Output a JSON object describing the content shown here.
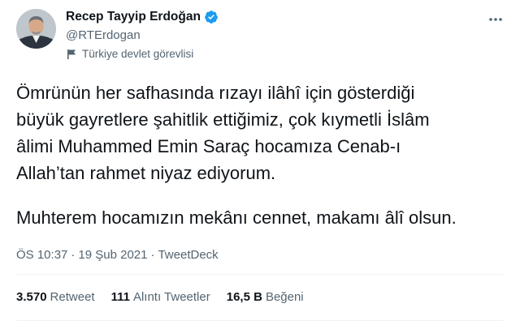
{
  "author": {
    "name": "Recep Tayyip Erdoğan",
    "handle": "@RTErdogan",
    "label": "Türkiye devlet görevlisi",
    "verified": true
  },
  "tweet": {
    "lines": [
      "Ömrünün her safhasında rızayı ilâhî için gösterdiği",
      "büyük gayretlere şahitlik ettiğimiz, çok kıymetli İslâm",
      "âlimi Muhammed Emin Saraç hocamıza Cenab-ı",
      "Allah’tan rahmet niyaz ediyorum."
    ],
    "line2": "Muhterem hocamızın mekânı cennet, makamı âlî olsun."
  },
  "meta": {
    "time": "ÖS 10:37",
    "date": "19 Şub 2021",
    "source": "TweetDeck",
    "separator": "·"
  },
  "stats": [
    {
      "value": "3.570",
      "label": "Retweet"
    },
    {
      "value": "111",
      "label": "Alıntı Tweetler"
    },
    {
      "value": "16,5 B",
      "label": "Beğeni"
    }
  ],
  "icons": {
    "verified": "verified-badge-icon",
    "label": "flag-icon",
    "more": "more-options-icon"
  },
  "colors": {
    "accent": "#1d9bf0",
    "secondary_text": "#536471"
  }
}
